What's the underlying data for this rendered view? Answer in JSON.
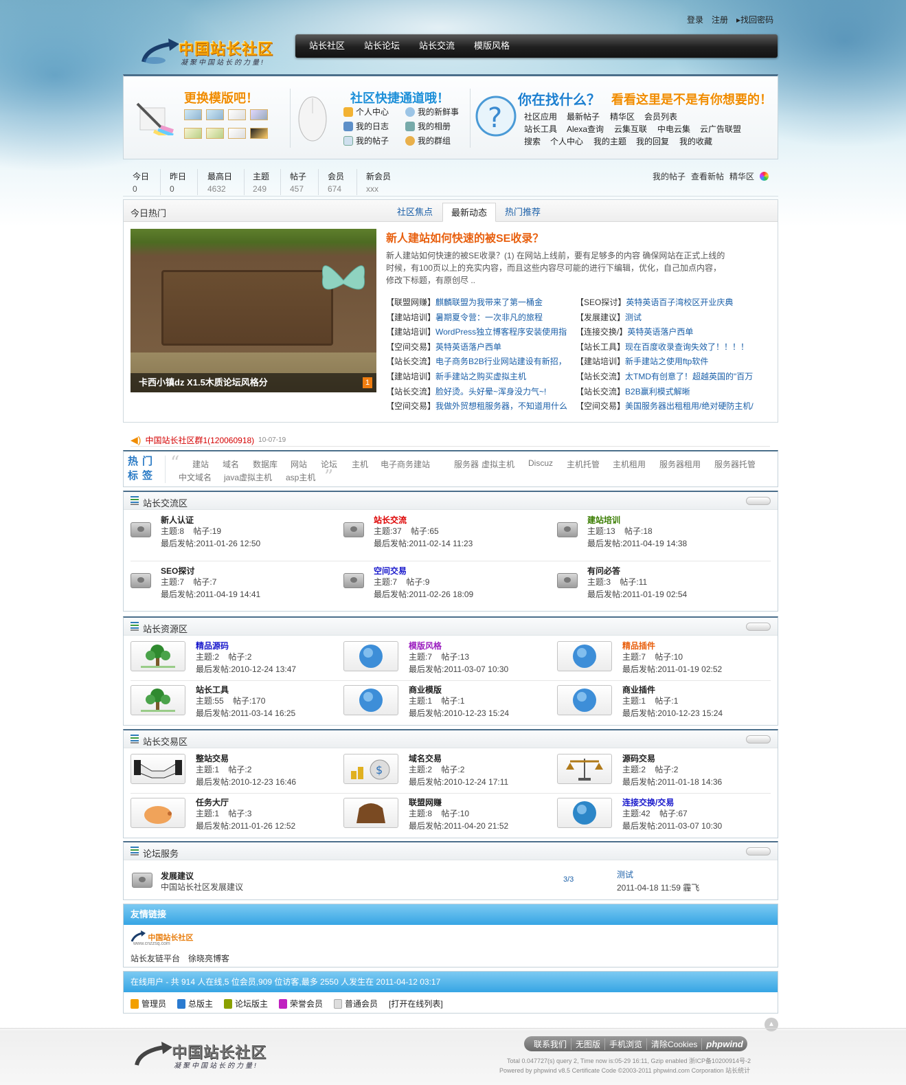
{
  "top_links": {
    "login": "登录",
    "register": "注册",
    "recover": "找回密码"
  },
  "logo": {
    "title": "中国站长社区",
    "slogan": "凝聚中国站长的力量!"
  },
  "nav": [
    "站长社区",
    "站长论坛",
    "站长交流",
    "模版风格"
  ],
  "banner": {
    "skin_title": "更换模版吧！",
    "quick_title": "社区快捷通道哦！",
    "quick_links": [
      "个人中心",
      "我的新鲜事",
      "我的日志",
      "我的相册",
      "我的帖子",
      "我的群组"
    ],
    "find_title1": "你在找什么？",
    "find_title2": "看看这里是不是有你想要的！",
    "find_links": [
      [
        "社区应用",
        "最新帖子",
        "精华区",
        "会员列表"
      ],
      [
        "站长工具",
        "Alexa查询",
        "云集互联",
        "中电云集",
        "云广告联盟"
      ],
      [
        "搜索",
        "个人中心",
        "我的主题",
        "我的回复",
        "我的收藏"
      ]
    ]
  },
  "stats": [
    {
      "label": "今日",
      "value": "0"
    },
    {
      "label": "昨日",
      "value": "0"
    },
    {
      "label": "最高日",
      "value": "4632"
    },
    {
      "label": "主题",
      "value": "249"
    },
    {
      "label": "帖子",
      "value": "457"
    },
    {
      "label": "会员",
      "value": "674"
    },
    {
      "label": "新会员",
      "value": "xxx"
    }
  ],
  "stats_links": [
    "我的帖子",
    "查看新帖",
    "精华区"
  ],
  "hot": {
    "title": "今日热门",
    "tabs": [
      "社区焦点",
      "最新动态",
      "热门推荐"
    ],
    "image_caption": "卡西小镇dz X1.5木质论坛风格分",
    "image_index": "1",
    "headline": "新人建站如何快速的被SE收录？",
    "summary": "新人建站如何快速的被SE收录？(1) 在网站上线前，要有足够多的内容 确保网站在正式上线的时候，有100页以上的充实内容，而且这些内容尽可能的进行下编辑，优化，自己加点内容，修改下标题，有原创尽 ..",
    "left_items": [
      {
        "cat": "【联盟网赚】",
        "title": "麒麟联盟为我带来了第一桶金"
      },
      {
        "cat": "【建站培训】",
        "title": "暑期夏令营：一次非凡的旅程"
      },
      {
        "cat": "【建站培训】",
        "title": "WordPress独立博客程序安装使用指"
      },
      {
        "cat": "【空间交易】",
        "title": "英特英语落户西单"
      },
      {
        "cat": "【站长交流】",
        "title": "电子商务B2B行业网站建设有新招，"
      },
      {
        "cat": "【建站培训】",
        "title": "新手建站之购买虚拟主机"
      },
      {
        "cat": "【站长交流】",
        "title": "脸好烫。头好晕~浑身没力气~!"
      },
      {
        "cat": "【空间交易】",
        "title": "我做外贸想租服务器，不知道用什么"
      }
    ],
    "right_items": [
      {
        "cat": "【SEO探讨】",
        "title": "英特英语百子湾校区开业庆典"
      },
      {
        "cat": "【发展建议】",
        "title": "测试"
      },
      {
        "cat": "【连接交换/】",
        "title": "英特英语落户西单"
      },
      {
        "cat": "【站长工具】",
        "title": "现在百度收录查询失效了！！！！"
      },
      {
        "cat": "【建站培训】",
        "title": "新手建站之使用ftp软件"
      },
      {
        "cat": "【站长交流】",
        "title": "太TMD有创意了！超越英国的\"百万"
      },
      {
        "cat": "【站长交流】",
        "title": "B2B赢利模式解晰"
      },
      {
        "cat": "【空间交易】",
        "title": "美国服务器出租租用/绝对硬防主机/"
      }
    ]
  },
  "qq": {
    "text": "中国站长社区群1(120060918)",
    "date": "10-07-19"
  },
  "tags": {
    "label": "热门标签",
    "row1": [
      "建站",
      "域名",
      "数据库",
      "网站",
      "论坛",
      "主机",
      "电子商务建站",
      "服务器",
      "虚拟主机",
      "Discuz",
      "主机托管",
      "主机租用",
      "服务器租用",
      "服务器托管"
    ],
    "row2": [
      "中文域名",
      "java虚拟主机",
      "asp主机"
    ]
  },
  "cat1": {
    "title": "站长交流区",
    "forums": [
      {
        "name": "新人认证",
        "name_color": "#222222",
        "topics": "主题:8",
        "posts": "帖子:19",
        "last": "最后发帖:2011-01-26 12:50"
      },
      {
        "name": "站长交流",
        "name_color": "#dd0000",
        "topics": "主题:37",
        "posts": "帖子:65",
        "last": "最后发帖:2011-02-14 11:23"
      },
      {
        "name": "建站培训",
        "name_color": "#3a7d00",
        "topics": "主题:13",
        "posts": "帖子:18",
        "last": "最后发帖:2011-04-19 14:38"
      },
      {
        "name": "SEO探讨",
        "name_color": "#222222",
        "topics": "主题:7",
        "posts": "帖子:7",
        "last": "最后发帖:2011-04-19 14:41"
      },
      {
        "name": "空间交易",
        "name_color": "#1a1acc",
        "topics": "主题:7",
        "posts": "帖子:9",
        "last": "最后发帖:2011-02-26 18:09"
      },
      {
        "name": "有问必答",
        "name_color": "#222222",
        "topics": "主题:3",
        "posts": "帖子:11",
        "last": "最后发帖:2011-01-19 02:54"
      }
    ]
  },
  "cat2": {
    "title": "站长资源区",
    "forums": [
      {
        "name": "精品源码",
        "name_color": "#1a1acc",
        "topics": "主题:2",
        "posts": "帖子:2",
        "last": "最后发帖:2010-12-24 13:47",
        "icon": "tree"
      },
      {
        "name": "模版风格",
        "name_color": "#9b1fbf",
        "topics": "主题:7",
        "posts": "帖子:13",
        "last": "最后发帖:2011-03-07 10:30",
        "icon": "globe"
      },
      {
        "name": "精品插件",
        "name_color": "#e8600f",
        "topics": "主题:7",
        "posts": "帖子:10",
        "last": "最后发帖:2011-01-19 02:52",
        "icon": "globe"
      },
      {
        "name": "站长工具",
        "name_color": "#222222",
        "topics": "主题:55",
        "posts": "帖子:170",
        "last": "最后发帖:2011-03-14 16:25",
        "icon": "tree"
      },
      {
        "name": "商业模版",
        "name_color": "#222222",
        "topics": "主题:1",
        "posts": "帖子:1",
        "last": "最后发帖:2010-12-23 15:24",
        "icon": "globe"
      },
      {
        "name": "商业插件",
        "name_color": "#222222",
        "topics": "主题:1",
        "posts": "帖子:1",
        "last": "最后发帖:2010-12-23 15:24",
        "icon": "globe"
      }
    ]
  },
  "cat3": {
    "title": "站长交易区",
    "forums": [
      {
        "name": "整站交易",
        "name_color": "#222222",
        "topics": "主题:1",
        "posts": "帖子:2",
        "last": "最后发帖:2010-12-23 16:46",
        "icon": "handshake"
      },
      {
        "name": "域名交易",
        "name_color": "#222222",
        "topics": "主题:2",
        "posts": "帖子:2",
        "last": "最后发帖:2010-12-24 17:11",
        "icon": "money"
      },
      {
        "name": "源码交易",
        "name_color": "#222222",
        "topics": "主题:2",
        "posts": "帖子:2",
        "last": "最后发帖:2011-01-18 14:36",
        "icon": "scale"
      },
      {
        "name": "任务大厅",
        "name_color": "#222222",
        "topics": "主题:1",
        "posts": "帖子:3",
        "last": "最后发帖:2011-01-26 12:52",
        "icon": "pig"
      },
      {
        "name": "联盟网赚",
        "name_color": "#222222",
        "topics": "主题:8",
        "posts": "帖子:10",
        "last": "最后发帖:2011-04-20 21:52",
        "icon": "purse"
      },
      {
        "name": "连接交换/交易",
        "name_color": "#1a1acc",
        "topics": "主题:42",
        "posts": "帖子:67",
        "last": "最后发帖:2011-03-07 10:30",
        "icon": "exchange"
      }
    ]
  },
  "cat4": {
    "title": "论坛服务",
    "forum": {
      "name": "发展建议",
      "desc": "中国站长社区发展建议",
      "count": "3/3",
      "last_title": "测试",
      "last_info": "2011-04-18 11:59 霾飞"
    }
  },
  "links": {
    "title": "友情链接",
    "logo_text": "中国站长社区",
    "logo_url": "www.cnzzsq.com",
    "items": [
      "站长友链平台",
      "徐晓亮博客"
    ]
  },
  "online": {
    "text": "在线用户 - 共 914 人在线,5 位会员,909 位访客,最多 2550 人发生在 2011-04-12 03:17",
    "legend": [
      {
        "label": "管理员",
        "color": "#f2a000"
      },
      {
        "label": "总版主",
        "color": "#2a7bd0"
      },
      {
        "label": "论坛版主",
        "color": "#8aa000"
      },
      {
        "label": "荣誉会员",
        "color": "#c020c0"
      },
      {
        "label": "普通会员",
        "color": "#bbbbbb"
      }
    ],
    "toggle": "[打开在线列表]"
  },
  "footer": {
    "links": [
      "联系我们",
      "无图版",
      "手机浏览",
      "清除Cookies"
    ],
    "brand": "phpwind",
    "line1": "Total 0.047727(s) query 2, Time now is:05-29 16:11, Gzip enabled 浙ICP备10200914号-2",
    "line2": "Powered by phpwind v8.5 Certificate Code ©2003-2011 phpwind.com Corporation 站长统计"
  }
}
